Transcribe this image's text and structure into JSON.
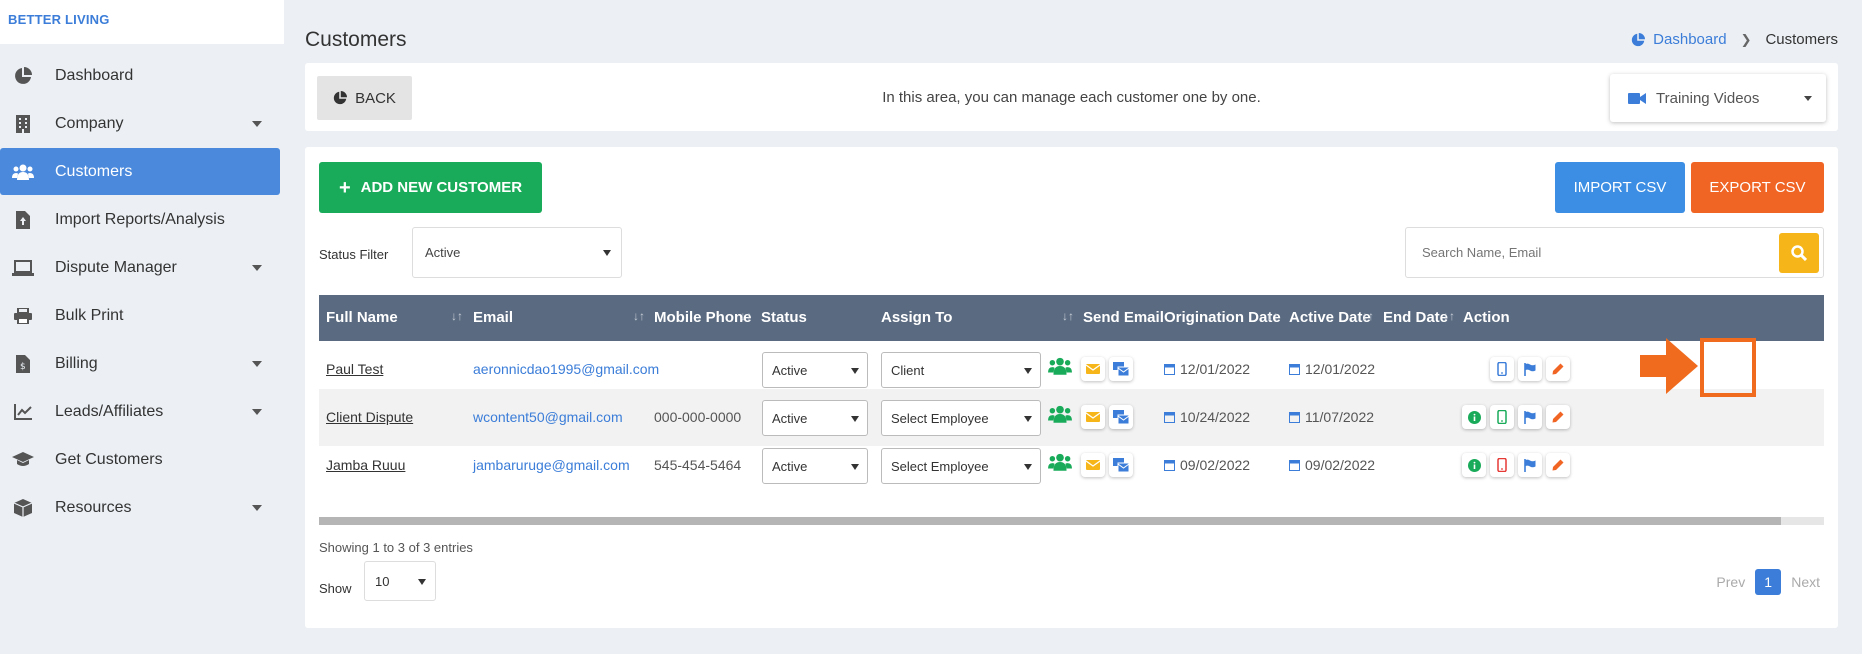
{
  "brand": "BETTER LIVING",
  "sidebar": {
    "items": [
      {
        "label": "Dashboard",
        "icon": "pie-chart-icon",
        "caret": false,
        "active": false
      },
      {
        "label": "Company",
        "icon": "building-icon",
        "caret": true,
        "active": false
      },
      {
        "label": "Customers",
        "icon": "users-icon",
        "caret": false,
        "active": true
      },
      {
        "label": "Import Reports/Analysis",
        "icon": "file-upload-icon",
        "caret": false,
        "active": false
      },
      {
        "label": "Dispute Manager",
        "icon": "laptop-icon",
        "caret": true,
        "active": false
      },
      {
        "label": "Bulk Print",
        "icon": "printer-icon",
        "caret": false,
        "active": false
      },
      {
        "label": "Billing",
        "icon": "invoice-icon",
        "caret": true,
        "active": false
      },
      {
        "label": "Leads/Affiliates",
        "icon": "line-chart-icon",
        "caret": true,
        "active": false
      },
      {
        "label": "Get Customers",
        "icon": "graduation-cap-icon",
        "caret": false,
        "active": false
      },
      {
        "label": "Resources",
        "icon": "box-icon",
        "caret": true,
        "active": false
      }
    ]
  },
  "header": {
    "title": "Customers",
    "breadcrumb": {
      "home": "Dashboard",
      "current": "Customers"
    }
  },
  "topbar": {
    "back_label": "BACK",
    "info": "In this area, you can manage each customer one by one.",
    "training_label": "Training Videos"
  },
  "toolbar": {
    "add_label": "ADD NEW CUSTOMER",
    "import_label": "IMPORT CSV",
    "export_label": "EXPORT CSV",
    "status_filter_label": "Status Filter",
    "status_filter_value": "Active",
    "search_placeholder": "Search Name, Email"
  },
  "table": {
    "columns": [
      "Full Name",
      "Email",
      "Mobile Phone",
      "Status",
      "Assign To",
      "Send Email",
      "Origination Date",
      "Active Date",
      "End Date",
      "Action"
    ],
    "rows": [
      {
        "name": "Paul Test",
        "email": "aeronnicdao1995@gmail.com",
        "phone": "",
        "status": "Active",
        "assign": "Client",
        "origination": "12/01/2022",
        "active": "12/01/2022",
        "end": "",
        "phone_icon_color": "#3b7dd8"
      },
      {
        "name": "Client Dispute",
        "email": "wcontent50@gmail.com",
        "phone": "000-000-0000",
        "status": "Active",
        "assign": "Select Employee",
        "origination": "10/24/2022",
        "active": "11/07/2022",
        "end": "",
        "phone_icon_color": "#1aab5a"
      },
      {
        "name": "Jamba Ruuu",
        "email": "jambaruruge@gmail.com",
        "phone": "545-454-5464",
        "status": "Active",
        "assign": "Select Employee",
        "origination": "09/02/2022",
        "active": "09/02/2022",
        "end": "",
        "phone_icon_color": "#e53935"
      }
    ]
  },
  "footer": {
    "showing": "Showing 1 to 3 of 3 entries",
    "show_label": "Show",
    "page_size": "10",
    "prev": "Prev",
    "current_page": "1",
    "next": "Next"
  },
  "colors": {
    "primary": "#4a89dc",
    "success": "#1aab5a",
    "warning": "#f6b619",
    "danger": "#f06424",
    "header": "#5a6a80",
    "highlight": "#f06b1e"
  }
}
